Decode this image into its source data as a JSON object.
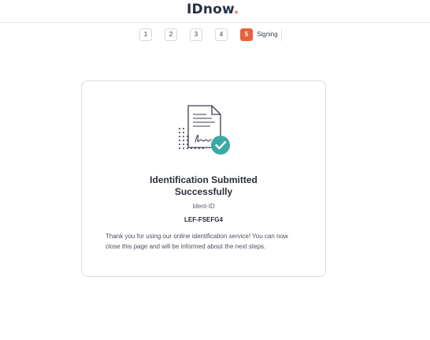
{
  "header": {
    "logo_text": "IDnow",
    "logo_dot": "."
  },
  "stepper": {
    "steps": [
      "1",
      "2",
      "3",
      "4",
      "5"
    ],
    "active_step": "5",
    "active_label": "Signing"
  },
  "card": {
    "icon": "signed-document-check-icon",
    "title_line1": "Identification Submitted",
    "title_line2": "Successfully",
    "ident_label": "Ident-ID",
    "ident_value": "LEF-FSEFG4",
    "message": "Thank you for using our online identification service! You can now close this page and will be informed about the next steps."
  },
  "colors": {
    "accent": "#e8613a",
    "success": "#3aa9a3",
    "brand_text": "#283047"
  }
}
